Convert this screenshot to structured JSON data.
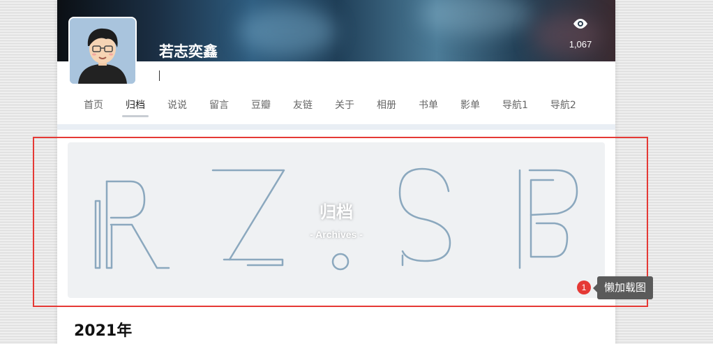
{
  "header": {
    "site_name": "若志奕鑫",
    "view_count": "1,067"
  },
  "nav": {
    "tabs": [
      {
        "label": "首页",
        "active": false
      },
      {
        "label": "归档",
        "active": true
      },
      {
        "label": "说说",
        "active": false
      },
      {
        "label": "留言",
        "active": false
      },
      {
        "label": "豆瓣",
        "active": false
      },
      {
        "label": "友链",
        "active": false
      },
      {
        "label": "关于",
        "active": false
      },
      {
        "label": "相册",
        "active": false
      },
      {
        "label": "书单",
        "active": false
      },
      {
        "label": "影单",
        "active": false
      },
      {
        "label": "导航1",
        "active": false
      },
      {
        "label": "导航2",
        "active": false
      }
    ]
  },
  "archive": {
    "title": "归档",
    "subtitle": "- Archives -",
    "background_letters": "RZ.SB",
    "year_heading": "2021年"
  },
  "annotation": {
    "badge": "1",
    "label": "懒加载图",
    "color": "#e53935"
  },
  "colors": {
    "outline_letters": "#8ba8be",
    "hero_bg": "#eff1f3",
    "nav_active_underline": "#c8cdd3"
  },
  "icons": {
    "views": "eye-icon"
  }
}
